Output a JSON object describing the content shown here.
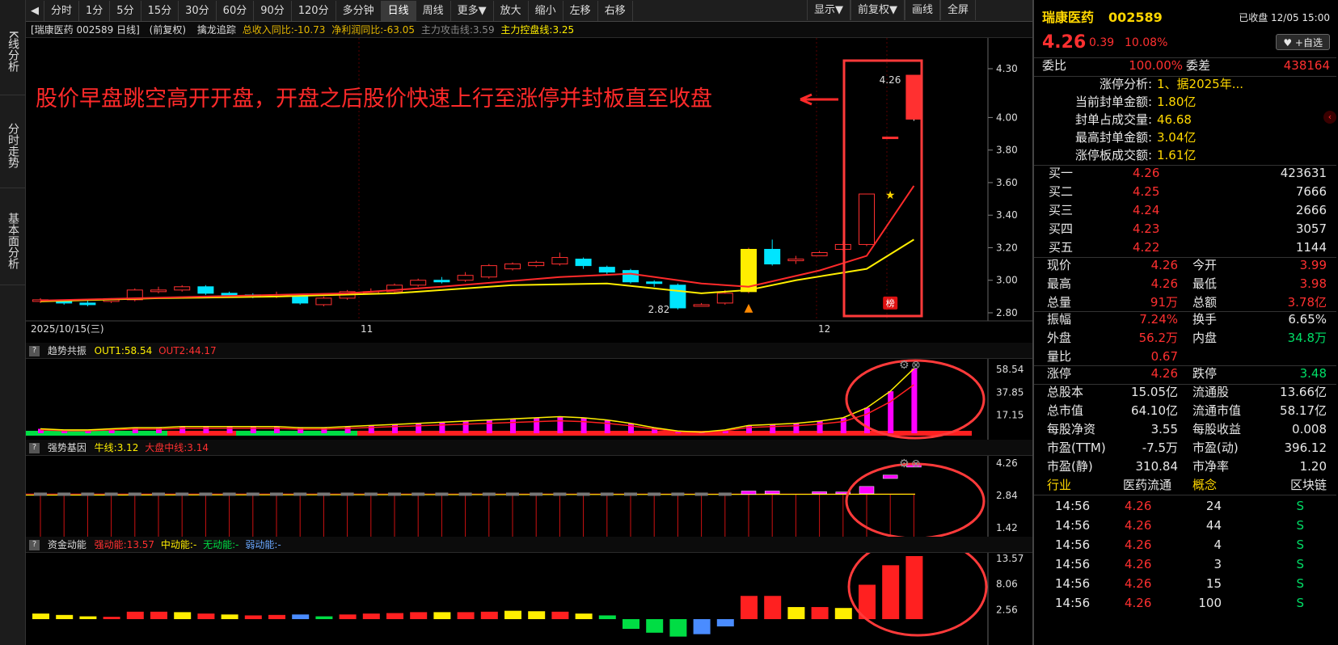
{
  "side_tabs": [
    "K线分析",
    "分时走势",
    "基本面分析"
  ],
  "toolbar": {
    "items": [
      "分时",
      "1分",
      "5分",
      "15分",
      "30分",
      "60分",
      "90分",
      "120分",
      "多分钟",
      "日线",
      "周线",
      "更多▼",
      "放大",
      "缩小",
      "左移",
      "右移"
    ],
    "active": "日线",
    "right": [
      "显示▼",
      "前复权▼",
      "画线",
      "全屏"
    ],
    "back_icon": "◀"
  },
  "main_info": {
    "stock": "[瑞康医药 002589 日线]",
    "adj": "(前复权)",
    "indicator": "擒龙追踪",
    "profit": "总收入同比:-10.73",
    "net": "净利润同比:-63.05",
    "attack": "主力攻击线:3.59",
    "control": "主力控盘线:3.25"
  },
  "annotation": "股价早盘跳空高开开盘，开盘之后股价快速上行至涨停并封板直至收盘",
  "price_chart": {
    "y_ticks": [
      "4.30",
      "4.00",
      "3.80",
      "3.60",
      "3.40",
      "3.20",
      "3.00",
      "2.80"
    ],
    "high_label": "4.26",
    "low_label": "2.82",
    "badge": "榜",
    "dates": [
      "2025/10/15(三)",
      "11",
      "12"
    ],
    "candles": [
      [
        2.87,
        2.88,
        2.89,
        2.86
      ],
      [
        2.87,
        2.86,
        2.88,
        2.85
      ],
      [
        2.86,
        2.85,
        2.88,
        2.84
      ],
      [
        2.87,
        2.88,
        2.89,
        2.86
      ],
      [
        2.88,
        2.94,
        2.95,
        2.87
      ],
      [
        2.93,
        2.94,
        2.96,
        2.92
      ],
      [
        2.94,
        2.96,
        2.97,
        2.93
      ],
      [
        2.96,
        2.92,
        2.97,
        2.91
      ],
      [
        2.92,
        2.91,
        2.93,
        2.9
      ],
      [
        2.91,
        2.9,
        2.92,
        2.89
      ],
      [
        2.9,
        2.91,
        2.93,
        2.89
      ],
      [
        2.9,
        2.86,
        2.91,
        2.85
      ],
      [
        2.85,
        2.89,
        2.9,
        2.84
      ],
      [
        2.89,
        2.93,
        2.94,
        2.88
      ],
      [
        2.93,
        2.93,
        2.95,
        2.92
      ],
      [
        2.93,
        2.97,
        2.98,
        2.92
      ],
      [
        2.97,
        3.0,
        3.01,
        2.96
      ],
      [
        3.0,
        2.99,
        3.02,
        2.98
      ],
      [
        3.0,
        3.03,
        3.05,
        2.99
      ],
      [
        3.02,
        3.09,
        3.1,
        3.01
      ],
      [
        3.07,
        3.1,
        3.11,
        3.06
      ],
      [
        3.09,
        3.11,
        3.12,
        3.08
      ],
      [
        3.1,
        3.14,
        3.17,
        3.09
      ],
      [
        3.13,
        3.09,
        3.14,
        3.07
      ],
      [
        3.08,
        3.05,
        3.09,
        3.03
      ],
      [
        3.06,
        2.99,
        3.07,
        2.98
      ],
      [
        2.99,
        2.98,
        3.0,
        2.96
      ],
      [
        2.97,
        2.83,
        2.98,
        2.82
      ],
      [
        2.84,
        2.85,
        2.86,
        2.84
      ],
      [
        2.86,
        2.92,
        2.94,
        2.85
      ],
      [
        2.93,
        3.19,
        3.2,
        2.92
      ],
      [
        3.19,
        3.1,
        3.25,
        3.09
      ],
      [
        3.12,
        3.13,
        3.15,
        3.1
      ],
      [
        3.15,
        3.17,
        3.18,
        3.15
      ],
      [
        3.19,
        3.22,
        3.24,
        3.18
      ],
      [
        3.22,
        3.53,
        3.53,
        3.21
      ],
      [
        3.88,
        3.88,
        3.88,
        3.88
      ],
      [
        4.26,
        3.99,
        4.26,
        3.98
      ]
    ],
    "ma": [
      [
        0,
        2.875
      ],
      [
        7,
        2.9
      ],
      [
        13,
        2.92
      ],
      [
        17,
        2.96
      ],
      [
        22,
        3.02
      ],
      [
        25,
        3.04
      ],
      [
        28,
        2.98
      ],
      [
        30,
        2.96
      ],
      [
        33,
        3.06
      ],
      [
        35,
        3.15
      ],
      [
        37,
        3.58
      ]
    ],
    "ma2": [
      [
        0,
        2.87
      ],
      [
        5,
        2.89
      ],
      [
        10,
        2.9
      ],
      [
        15,
        2.92
      ],
      [
        20,
        2.97
      ],
      [
        24,
        2.98
      ],
      [
        28,
        2.92
      ],
      [
        30,
        2.94
      ],
      [
        32,
        3.0
      ],
      [
        35,
        3.07
      ],
      [
        37,
        3.25
      ]
    ]
  },
  "ind1": {
    "name": "趋势共振",
    "out1": "OUT1:58.54",
    "out2": "OUT2:44.17",
    "ticks": [
      "58.54",
      "37.85",
      "17.15"
    ],
    "values": [
      4,
      3,
      3,
      4,
      5,
      5,
      6,
      6,
      6,
      6,
      6,
      5,
      5,
      6,
      7,
      8,
      9,
      10,
      11,
      12,
      13,
      14,
      15,
      14,
      12,
      9,
      5,
      2,
      1,
      3,
      7,
      8,
      9,
      11,
      14,
      23,
      38,
      58.5
    ]
  },
  "ind2": {
    "name": "强势基因",
    "bull": "牛线:3.12",
    "mid": "大盘中线:3.14",
    "ticks": [
      "4.26",
      "2.84",
      "1.42"
    ]
  },
  "ind3": {
    "name": "资金动能",
    "strong": "强动能:13.57",
    "medium": "中动能:-",
    "none": "无动能:-",
    "weak": "弱动能:-",
    "ticks": [
      "13.57",
      "8.06",
      "2.56"
    ],
    "values": [
      [
        1.2,
        "#ffee00"
      ],
      [
        0.9,
        "#ffee00"
      ],
      [
        0.6,
        "#ffee00"
      ],
      [
        0.5,
        "#ff2020"
      ],
      [
        1.6,
        "#ff2020"
      ],
      [
        1.6,
        "#ff2020"
      ],
      [
        1.5,
        "#ffee00"
      ],
      [
        1.2,
        "#ff2020"
      ],
      [
        1.0,
        "#ffee00"
      ],
      [
        0.8,
        "#ff2020"
      ],
      [
        0.9,
        "#ff2020"
      ],
      [
        1.0,
        "#4a8cff"
      ],
      [
        0.6,
        "#00dd44"
      ],
      [
        1.0,
        "#ff2020"
      ],
      [
        1.2,
        "#ff2020"
      ],
      [
        1.3,
        "#ff2020"
      ],
      [
        1.5,
        "#ff2020"
      ],
      [
        1.5,
        "#ffee00"
      ],
      [
        1.5,
        "#ff2020"
      ],
      [
        1.6,
        "#ff2020"
      ],
      [
        1.8,
        "#ffee00"
      ],
      [
        1.7,
        "#ffee00"
      ],
      [
        1.6,
        "#ff2020"
      ],
      [
        1.2,
        "#ffee00"
      ],
      [
        0.8,
        "#00dd44"
      ],
      [
        -2.0,
        "#00dd44"
      ],
      [
        -2.8,
        "#00dd44"
      ],
      [
        -3.6,
        "#00dd44"
      ],
      [
        -3.1,
        "#4a8cff"
      ],
      [
        -1.5,
        "#4a8cff"
      ],
      [
        5.0,
        "#ff2020"
      ],
      [
        5.0,
        "#ff2020"
      ],
      [
        2.6,
        "#ffee00"
      ],
      [
        2.6,
        "#ff2020"
      ],
      [
        2.4,
        "#ffee00"
      ],
      [
        7.4,
        "#ff2020"
      ],
      [
        11.6,
        "#ff2020"
      ],
      [
        13.57,
        "#ff2020"
      ]
    ]
  },
  "panel": {
    "name": "瑞康医药",
    "code": "002589",
    "status": "已收盘 12/05 15:00",
    "price": "4.26",
    "change": "0.39",
    "pct": "10.08%",
    "watch": "+自选",
    "weibi_l": "委比",
    "weibi": "100.00%",
    "weicha_l": "委差",
    "weicha": "438164",
    "limit_rows": [
      [
        "涨停分析:",
        "1、据2025年..."
      ],
      [
        "当前封单金额:",
        "1.80亿"
      ],
      [
        "封单占成交量:",
        "46.68"
      ],
      [
        "最高封单金额:",
        "3.04亿"
      ],
      [
        "涨停板成交额:",
        "1.61亿"
      ]
    ],
    "bids": [
      [
        "买一",
        "4.26",
        "423631"
      ],
      [
        "买二",
        "4.25",
        "7666"
      ],
      [
        "买三",
        "4.24",
        "2666"
      ],
      [
        "买四",
        "4.23",
        "3057"
      ],
      [
        "买五",
        "4.22",
        "1144"
      ]
    ],
    "stats": [
      [
        "现价",
        "4.26",
        "今开",
        "3.99"
      ],
      [
        "最高",
        "4.26",
        "最低",
        "3.98"
      ],
      [
        "总量",
        "91万",
        "总额",
        "3.78亿"
      ]
    ],
    "stats2": [
      [
        "振幅",
        "7.24%",
        "换手",
        "6.65%"
      ],
      [
        "外盘",
        "56.2万",
        "内盘",
        "34.8万"
      ],
      [
        "量比",
        "0.67",
        "",
        ""
      ]
    ],
    "limits": [
      [
        "涨停",
        "4.26",
        "跌停",
        "3.48"
      ]
    ],
    "fund": [
      [
        "总股本",
        "15.05亿",
        "流通股",
        "13.66亿"
      ],
      [
        "总市值",
        "64.10亿",
        "流通市值",
        "58.17亿"
      ],
      [
        "每股净资",
        "3.55",
        "每股收益",
        "0.008"
      ],
      [
        "市盈(TTM)",
        "-7.5万",
        "市盈(动)",
        "396.12"
      ],
      [
        "市盈(静)",
        "310.84",
        "市净率",
        "1.20"
      ]
    ],
    "industry": [
      "行业",
      "医药流通",
      "概念",
      "区块链"
    ],
    "ticks": [
      [
        "14:56",
        "4.26",
        "24",
        "S"
      ],
      [
        "14:56",
        "4.26",
        "44",
        "S"
      ],
      [
        "14:56",
        "4.26",
        "4",
        "S"
      ],
      [
        "14:56",
        "4.26",
        "3",
        "S"
      ],
      [
        "14:56",
        "4.26",
        "15",
        "S"
      ],
      [
        "14:56",
        "4.26",
        "100",
        "S"
      ]
    ]
  }
}
